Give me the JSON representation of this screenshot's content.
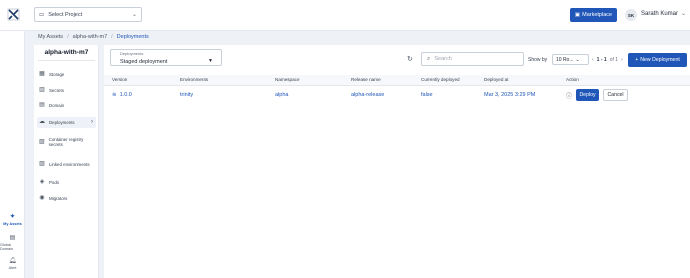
{
  "topbar": {
    "logo_icon": "logo-icon",
    "project_placeholder": "Select Project",
    "marketplace_label": "Marketplace",
    "avatar_initials": "SK",
    "username": "Sarath Kumar"
  },
  "rail": [
    {
      "label": "My Assets",
      "icon": "assets-icon",
      "active": true
    },
    {
      "label": "Global Domain",
      "icon": "domain-icon",
      "active": false
    },
    {
      "label": "Alert",
      "icon": "bell-icon",
      "active": false
    }
  ],
  "breadcrumb": [
    "My Assets",
    "alpha-with-m7",
    "Deployments"
  ],
  "asset": {
    "title": "alpha-with-m7",
    "menu": [
      {
        "label": "Storage",
        "icon": "storage-icon"
      },
      {
        "label": "Secrets",
        "icon": "secrets-icon"
      },
      {
        "label": "Domain",
        "icon": "domain-icon"
      },
      {
        "label": "Deployments",
        "icon": "cloud-icon"
      },
      {
        "label": "Container registry secrets",
        "icon": "registry-icon"
      },
      {
        "label": "Linked environments",
        "icon": "link-icon"
      },
      {
        "label": "Pods",
        "icon": "pods-icon"
      },
      {
        "label": "Migrators",
        "icon": "migrate-icon"
      }
    ]
  },
  "toolbar": {
    "deployment_label": "Deployments",
    "deployment_value": "Staged deployment",
    "search_placeholder": "Search",
    "show_by_label": "Show by",
    "show_by_value": "10 Ro...",
    "pager_range": "1 - 1",
    "pager_of": "of 1",
    "new_button": "New Deployment"
  },
  "table": {
    "headers": [
      "Version",
      "Environments",
      "Namespace",
      "Release name",
      "Currently deployed",
      "Deployed at",
      "Action"
    ],
    "rows": [
      {
        "version": "1.0.0",
        "environment": "trinity",
        "namespace": "alpha",
        "release": "alpha-release",
        "deployed": "false",
        "deployed_at": "Mar 3, 2025 3:29 PM",
        "deploy": "Deploy",
        "cancel": "Cancel"
      }
    ]
  },
  "colors": {
    "accent": "#1f56b8",
    "background": "#eef1f6"
  }
}
